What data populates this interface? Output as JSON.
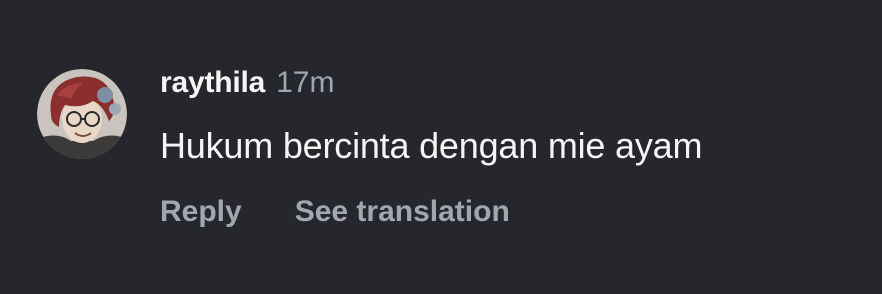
{
  "comment": {
    "avatar_icon": "user-avatar",
    "username": "raythila",
    "timestamp": "17m",
    "text": "Hukum bercinta dengan mie ayam",
    "actions": {
      "reply_label": "Reply",
      "translate_label": "See translation"
    }
  },
  "colors": {
    "background": "#25272c",
    "primary_text": "#f5f5f5",
    "secondary_text": "#a2a6ad"
  }
}
